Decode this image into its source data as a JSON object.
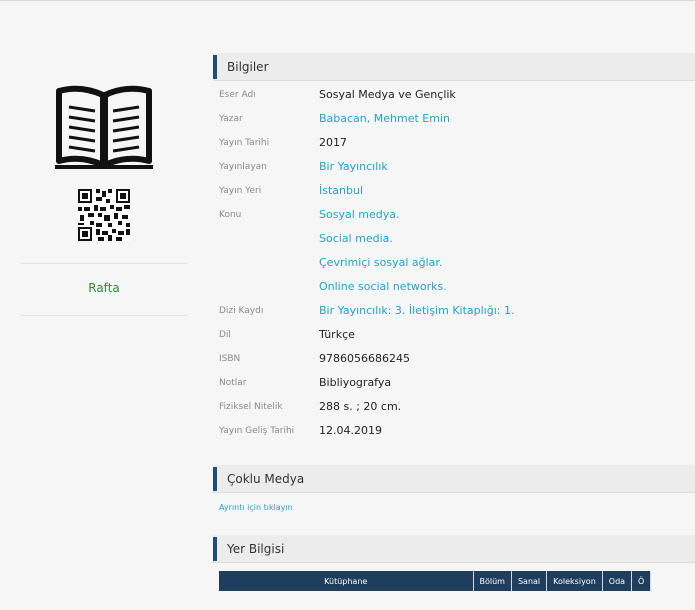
{
  "left": {
    "status_label": "Rafta",
    "status_color": "#2e8b3a",
    "icons": [
      "open-book-icon",
      "qr-code-icon"
    ]
  },
  "sections": {
    "bilgiler": "Bilgiler",
    "coklu_medya": "Çoklu Medya",
    "yer_bilgisi": "Yer Bilgisi"
  },
  "info": [
    {
      "label": "Eser Adı",
      "values": [
        "Sosyal Medya ve Gençlik"
      ],
      "link": false
    },
    {
      "label": "Yazar",
      "values": [
        "Babacan, Mehmet Emin"
      ],
      "link": true
    },
    {
      "label": "Yayın Tarihi",
      "values": [
        "2017"
      ],
      "link": false
    },
    {
      "label": "Yayınlayan",
      "values": [
        "Bir Yayıncılık"
      ],
      "link": true
    },
    {
      "label": "Yayın Yeri",
      "values": [
        "İstanbul"
      ],
      "link": true
    },
    {
      "label": "Konu",
      "values": [
        "Sosyal medya.",
        "Social media.",
        "Çevrimiçi sosyal ağlar.",
        "Online social networks."
      ],
      "link": true
    },
    {
      "label": "Dizi Kaydı",
      "values": [
        "Bir Yayıncılık: 3. İletişim Kitaplığı: 1."
      ],
      "link": true
    },
    {
      "label": "Dil",
      "values": [
        "Türkçe"
      ],
      "link": false
    },
    {
      "label": "ISBN",
      "values": [
        "9786056686245"
      ],
      "link": false
    },
    {
      "label": "Notlar",
      "values": [
        "Bibliyografya"
      ],
      "link": false
    },
    {
      "label": "Fiziksel Nitelik",
      "values": [
        "288 s. ; 20 cm."
      ],
      "link": false
    },
    {
      "label": "Yayın Geliş Tarihi",
      "values": [
        "12.04.2019"
      ],
      "link": false
    }
  ],
  "multimedia": {
    "link_text": "Ayrıntı için tıklayın"
  },
  "location_table": {
    "headers": [
      "Kütüphane",
      "Bölüm",
      "Sanal",
      "Koleksiyon",
      "Oda",
      "Ö"
    ]
  },
  "colors": {
    "link": "#27a1c6",
    "header_accent": "#1e4f7a",
    "table_header_bg": "#1f3e5e"
  }
}
